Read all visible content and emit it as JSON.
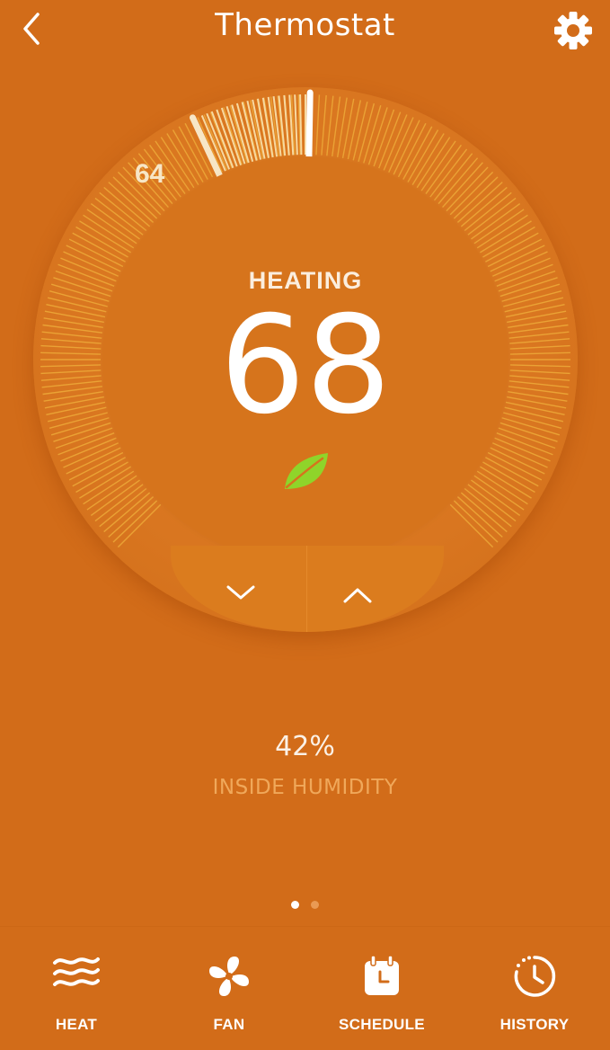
{
  "header": {
    "title": "Thermostat",
    "back_icon": "chevron-left-icon",
    "settings_icon": "gear-icon"
  },
  "dial": {
    "setpoint_low": "64",
    "status": "HEATING",
    "target_temperature": "68",
    "eco_icon": "leaf-icon",
    "decrease_icon": "chevron-down-icon",
    "increase_icon": "chevron-up-icon"
  },
  "humidity": {
    "value": "42%",
    "label": "INSIDE HUMIDITY"
  },
  "pager": {
    "active_page": 1,
    "total_pages": 2
  },
  "tabs": [
    {
      "label": "HEAT",
      "icon": "heat-waves-icon"
    },
    {
      "label": "FAN",
      "icon": "fan-icon"
    },
    {
      "label": "SCHEDULE",
      "icon": "calendar-clock-icon"
    },
    {
      "label": "HISTORY",
      "icon": "history-clock-icon"
    }
  ],
  "colors": {
    "background": "#d26c19",
    "leaf": "#8fd42a",
    "tick": "#f0b13c",
    "humidity_label": "#f0a85a"
  }
}
